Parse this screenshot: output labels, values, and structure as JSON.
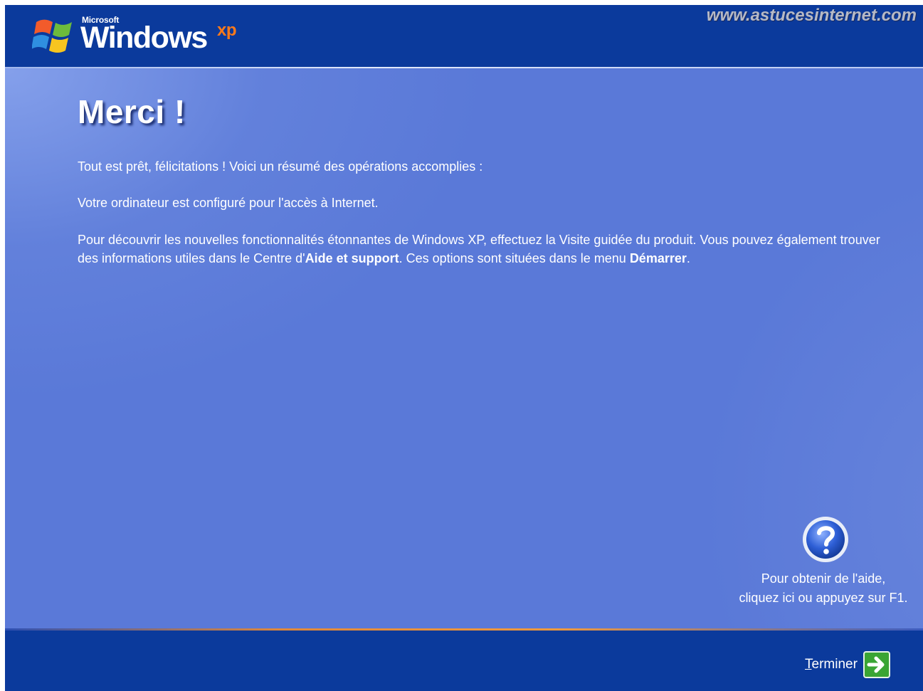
{
  "header": {
    "logo_brand": "Microsoft",
    "logo_product": "Windows",
    "logo_version": "xp",
    "watermark": "www.astucesinternet.com"
  },
  "main": {
    "title": "Merci !",
    "paragraph1": "Tout est prêt, félicitations ! Voici un résumé des opérations accomplies :",
    "paragraph2": "Votre ordinateur est configuré pour l'accès à Internet.",
    "paragraph3": {
      "part1": "Pour découvrir les nouvelles fonctionnalités étonnantes de Windows XP, effectuez la Visite guidée du produit. Vous pouvez également trouver des informations utiles dans le Centre d'",
      "bold1": "Aide et support",
      "part2": ". Ces options sont situées dans le menu ",
      "bold2": "Démarrer",
      "part3": "."
    }
  },
  "help": {
    "icon": "help-question-icon",
    "line1": "Pour obtenir de l'aide,",
    "line2": "cliquez ici ou appuyez sur F1."
  },
  "footer": {
    "finish_accel": "T",
    "finish_rest": "erminer",
    "finish_icon": "arrow-right-icon"
  },
  "colors": {
    "bar": "#0b3a9c",
    "background": "#5a79d8",
    "accent_orange": "#f29a3c",
    "arrow_green": "#3aa534"
  }
}
